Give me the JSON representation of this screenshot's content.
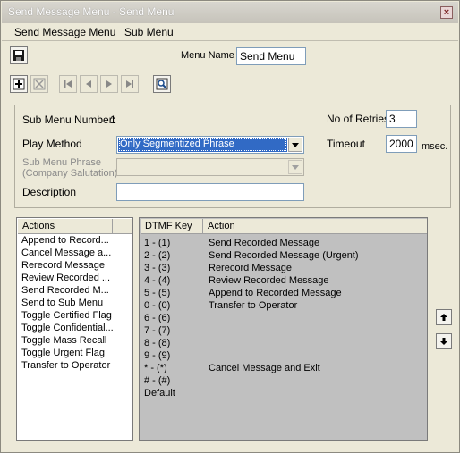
{
  "window": {
    "title": "Send Message Menu - Send Menu",
    "close_label": "×"
  },
  "menubar": {
    "items": [
      {
        "label": "Send Message Menu"
      },
      {
        "label": "Sub Menu"
      }
    ]
  },
  "toolbar": {
    "save_icon": "save-icon",
    "menu_name_label": "Menu Name",
    "menu_name_value": "Send Menu"
  },
  "form": {
    "sub_menu_number_label": "Sub Menu Number:",
    "sub_menu_number_value": "1",
    "play_method_label": "Play Method",
    "play_method_value": "Only Segmentized Phrase",
    "sub_menu_phrase_label_1": "Sub Menu Phrase",
    "sub_menu_phrase_label_2": "(Company Salutation)",
    "description_label": "Description",
    "description_value": "",
    "retries_label": "No of Retries",
    "retries_value": "3",
    "timeout_label": "Timeout",
    "timeout_value": "2000",
    "timeout_unit": "msec."
  },
  "actions_panel": {
    "header": "Actions",
    "items": [
      "Append to Record...",
      "Cancel Message a...",
      "Rerecord Message",
      "Review Recorded ...",
      "Send Recorded M...",
      "Send to Sub Menu",
      "Toggle Certified Flag",
      "Toggle Confidential...",
      "Toggle Mass Recall",
      "Toggle Urgent Flag",
      "Transfer to Operator"
    ]
  },
  "dtmf_panel": {
    "headers": {
      "key": "DTMF Key",
      "action": "Action"
    },
    "rows": [
      {
        "key": "1 - (1)",
        "action": "Send Recorded Message"
      },
      {
        "key": "2 - (2)",
        "action": "Send Recorded Message (Urgent)"
      },
      {
        "key": "3 - (3)",
        "action": "Rerecord Message"
      },
      {
        "key": "4 - (4)",
        "action": "Review Recorded Message"
      },
      {
        "key": "5 - (5)",
        "action": "Append to Recorded Message"
      },
      {
        "key": "0 - (0)",
        "action": "Transfer to Operator"
      },
      {
        "key": "6 - (6)",
        "action": ""
      },
      {
        "key": "7 - (7)",
        "action": ""
      },
      {
        "key": "8 - (8)",
        "action": ""
      },
      {
        "key": "9 - (9)",
        "action": ""
      },
      {
        "key": "* - (*)",
        "action": "Cancel Message and Exit"
      },
      {
        "key": "# - (#)",
        "action": ""
      },
      {
        "key": "Default",
        "action": ""
      }
    ]
  },
  "colors": {
    "selection": "#316ac5",
    "window_bg": "#ece9d8",
    "grid_bg": "#c0c0c0"
  }
}
